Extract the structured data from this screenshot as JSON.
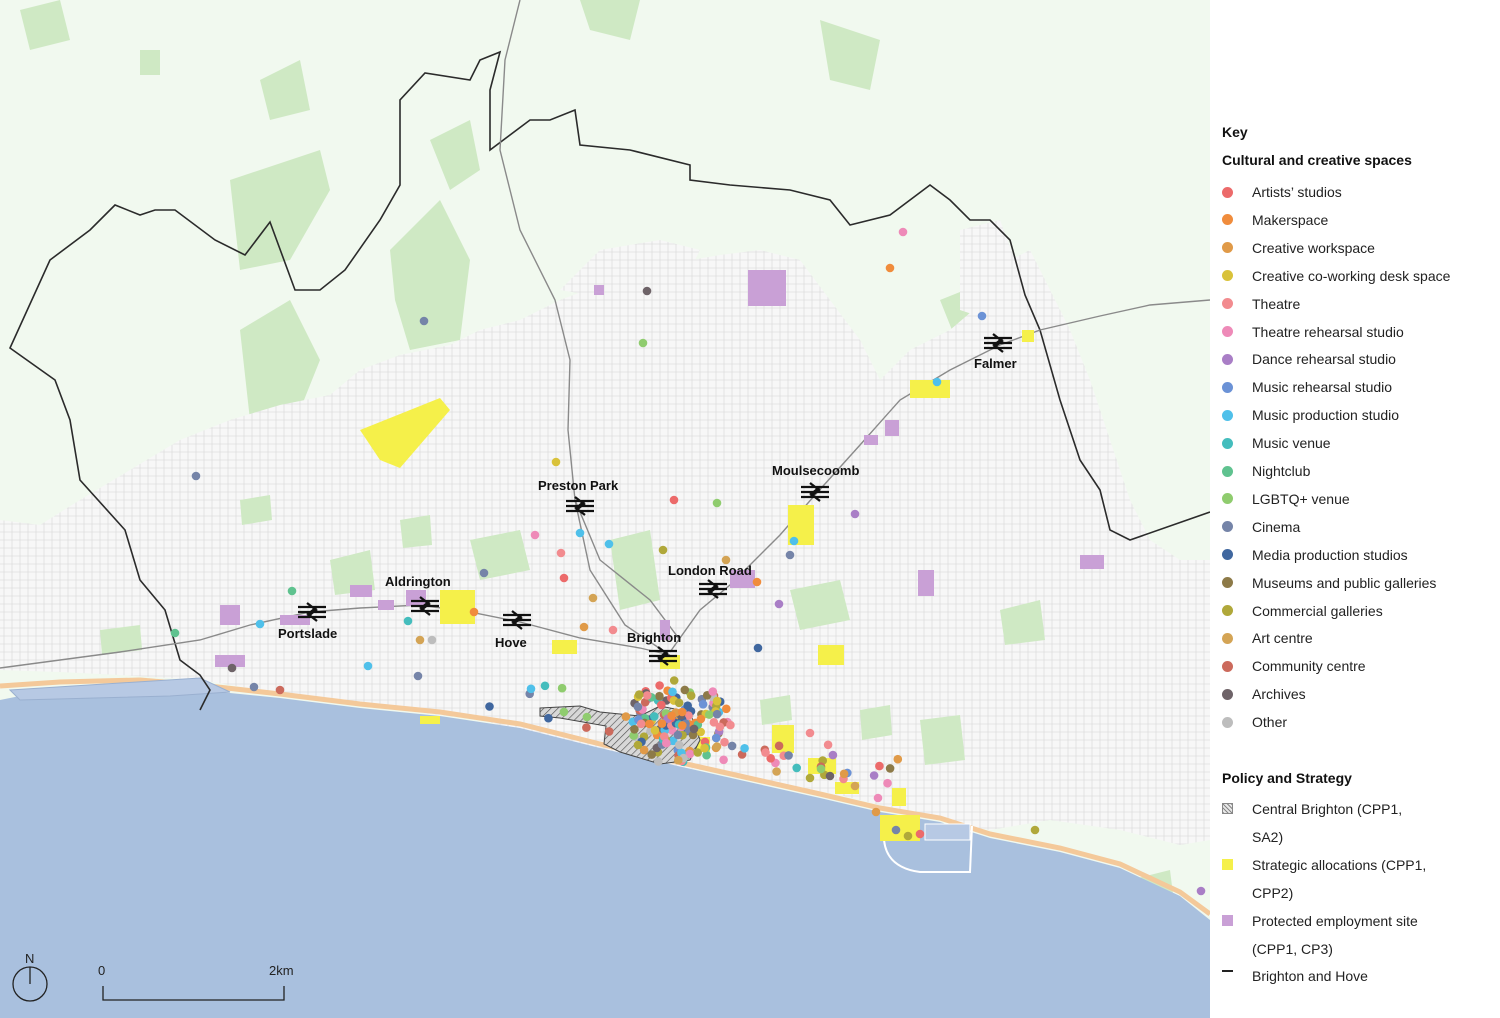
{
  "legend": {
    "key": "Key",
    "cultural_title": "Cultural and creative spaces",
    "cultural_items": [
      {
        "label": "Artists’ studios",
        "color": "#ec6a6a"
      },
      {
        "label": "Makerspace",
        "color": "#f08c3c"
      },
      {
        "label": "Creative workspace",
        "color": "#e09a48"
      },
      {
        "label": "Creative co-working desk space",
        "color": "#d9c23a"
      },
      {
        "label": "Theatre",
        "color": "#f28b8f"
      },
      {
        "label": "Theatre rehearsal studio",
        "color": "#ee8ab8"
      },
      {
        "label": "Dance rehearsal studio",
        "color": "#a97ec6"
      },
      {
        "label": "Music rehearsal studio",
        "color": "#6b92d6"
      },
      {
        "label": "Music production studio",
        "color": "#4fc0ea"
      },
      {
        "label": "Music venue",
        "color": "#44bdbd"
      },
      {
        "label": "Nightclub",
        "color": "#5fc28f"
      },
      {
        "label": "LGBTQ+ venue",
        "color": "#8fcc6e"
      },
      {
        "label": "Cinema",
        "color": "#7584a8"
      },
      {
        "label": "Media production studios",
        "color": "#40679f"
      },
      {
        "label": "Museums and public galleries",
        "color": "#8d7a48"
      },
      {
        "label": "Commercial galleries",
        "color": "#b0a83a"
      },
      {
        "label": "Art centre",
        "color": "#d4a455"
      },
      {
        "label": "Community centre",
        "color": "#cc6a5c"
      },
      {
        "label": "Archives",
        "color": "#6e6368"
      },
      {
        "label": "Other",
        "color": "#bdbdbd"
      }
    ],
    "policy_title": "Policy and Strategy",
    "policy_items": [
      {
        "line1": "Central Brighton (CPP1,",
        "line2": "SA2)",
        "type": "hatch",
        "color": "#888888"
      },
      {
        "line1": "Strategic allocations (CPP1,",
        "line2": "CPP2)",
        "type": "fill",
        "color": "#f5f04a"
      },
      {
        "line1": "Protected employment site",
        "line2": "(CPP1, CP3)",
        "type": "fill",
        "color": "#c9a0d6"
      },
      {
        "line1": "Brighton and Hove",
        "line2": "",
        "type": "line",
        "color": "#222222"
      }
    ]
  },
  "map": {
    "colors": {
      "sea": "#a9c0de",
      "land": "#f1f9ef",
      "green": "#cfe9c4",
      "urban": "#f6f6f6",
      "beach": "#f4c99a",
      "boundary": "#2b2b2b",
      "rail": "#8a8a8a"
    },
    "stations": [
      "Portslade",
      "Aldrington",
      "Hove",
      "Preston Park",
      "Brighton",
      "London Road",
      "Moulsecoomb",
      "Falmer"
    ],
    "north": "N",
    "scale": {
      "start": "0",
      "end": "2km"
    }
  }
}
